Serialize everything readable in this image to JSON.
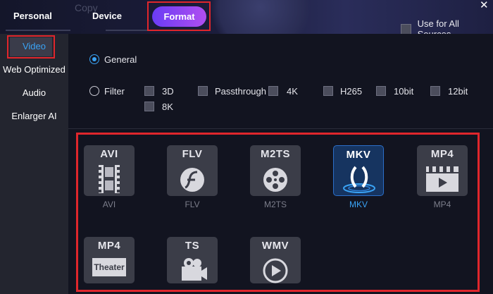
{
  "header": {
    "ghost_text": "Copy",
    "tabs": [
      {
        "label": "Personal"
      },
      {
        "label": "Device"
      },
      {
        "label": "Format",
        "active": true
      }
    ],
    "close_icon": "close-icon",
    "use_all_sources": {
      "label": "Use for All Sources",
      "checked": false
    }
  },
  "sidebar": {
    "items": [
      {
        "label": "Video",
        "active": true
      },
      {
        "label": "Web Optimized"
      },
      {
        "label": "Audio"
      },
      {
        "label": "Enlarger AI"
      }
    ]
  },
  "options": {
    "general": {
      "label": "General",
      "selected": true
    },
    "filter": {
      "label": "Filter",
      "selected": false
    },
    "filters": [
      {
        "label": "3D",
        "checked": false
      },
      {
        "label": "Passthrough",
        "checked": false
      },
      {
        "label": "4K",
        "checked": false
      },
      {
        "label": "H265",
        "checked": false
      },
      {
        "label": "10bit",
        "checked": false
      },
      {
        "label": "12bit",
        "checked": false
      },
      {
        "label": "8K",
        "checked": false
      }
    ]
  },
  "formats": [
    {
      "title": "AVI",
      "label": "AVI",
      "icon": "film-strip-icon"
    },
    {
      "title": "FLV",
      "label": "FLV",
      "icon": "flash-icon"
    },
    {
      "title": "M2TS",
      "label": "M2TS",
      "icon": "film-reel-icon"
    },
    {
      "title": "MKV",
      "label": "MKV",
      "icon": "mkv-logo-icon",
      "selected": true
    },
    {
      "title": "MP4",
      "label": "MP4",
      "icon": "clapper-play-icon"
    },
    {
      "title": "MP4",
      "badge": "Theater",
      "icon": "theater-icon"
    },
    {
      "title": "TS",
      "icon": "video-camera-icon"
    },
    {
      "title": "WMV",
      "icon": "play-circle-icon"
    }
  ],
  "colors": {
    "accent_blue": "#3aa3f5",
    "format_gradient_start": "#6a3cf5",
    "format_gradient_end": "#b04ef0",
    "highlight_red": "#e0262c",
    "card_bg": "#3b3d48",
    "card_selected_bg": "#163460"
  }
}
